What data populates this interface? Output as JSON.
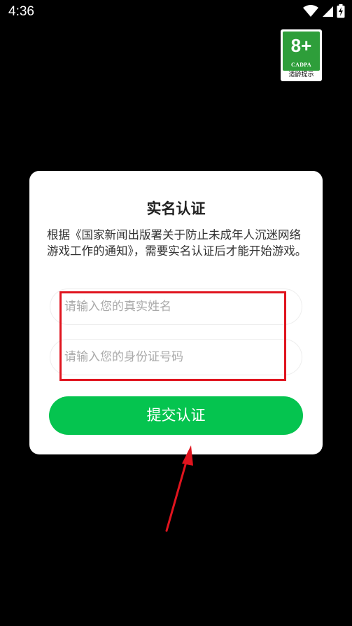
{
  "status_bar": {
    "time": "4:36"
  },
  "age_badge": {
    "rating": "8+",
    "org": "CADPA",
    "caption": "适龄提示"
  },
  "dialog": {
    "title": "实名认证",
    "description": "根据《国家新闻出版署关于防止未成年人沉迷网络游戏工作的通知》，需要实名认证后才能开始游戏。",
    "name_placeholder": "请输入您的真实姓名",
    "id_placeholder": "请输入您的身份证号码",
    "submit_label": "提交认证"
  },
  "colors": {
    "background": "#000000",
    "dialog": "#ffffff",
    "submit": "#05c44f",
    "highlight": "#e0141e",
    "badge_green": "#2e9e3a"
  },
  "icons": {
    "status": [
      "wifi-icon",
      "signal-icon",
      "battery-charging-icon"
    ],
    "annotation": "red-arrow-icon"
  }
}
